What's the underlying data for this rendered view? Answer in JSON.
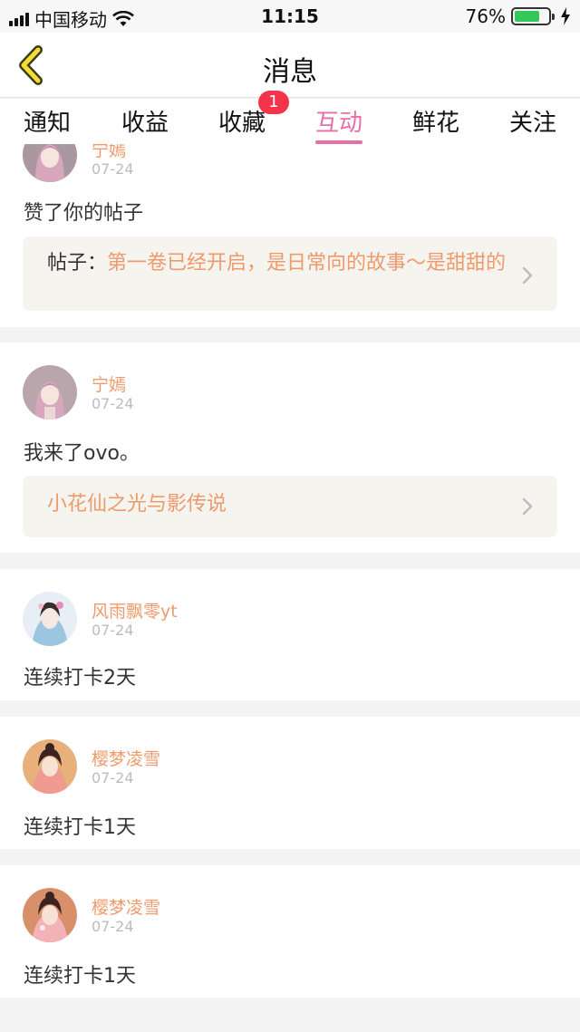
{
  "status_bar": {
    "carrier": "中国移动",
    "time": "11:15",
    "battery": "76%",
    "battery_level": 0.76,
    "icons": [
      "signal-icon",
      "wifi-icon",
      "battery-icon",
      "charging-icon"
    ]
  },
  "header": {
    "title": "消息",
    "back_icon": "chevron-left-icon"
  },
  "tabs": {
    "items": [
      {
        "label": "通知"
      },
      {
        "label": "收益"
      },
      {
        "label": "收藏",
        "badge": "1"
      },
      {
        "label": "互动",
        "active": true
      },
      {
        "label": "鲜花"
      },
      {
        "label": "关注"
      }
    ],
    "active_color": "#e86fa6",
    "badge_color": "#f5334b"
  },
  "feed": {
    "items": [
      {
        "user": "宁嫣",
        "date": "07-24",
        "text": "赞了你的帖子",
        "quote_label": "帖子：",
        "quote": "第一卷已经开启，是日常向的故事～是甜甜的"
      },
      {
        "user": "宁嫣",
        "date": "07-24",
        "text": "我来了ovo。",
        "quote": "小花仙之光与影传说"
      },
      {
        "user": "风雨飘零yt",
        "date": "07-24",
        "text": "连续打卡2天"
      },
      {
        "user": "樱梦凌雪",
        "date": "07-24",
        "text": "连续打卡1天"
      },
      {
        "user": "樱梦凌雪",
        "date": "07-24",
        "text": "连续打卡1天"
      }
    ],
    "accent_color": "#ee9a6c"
  }
}
